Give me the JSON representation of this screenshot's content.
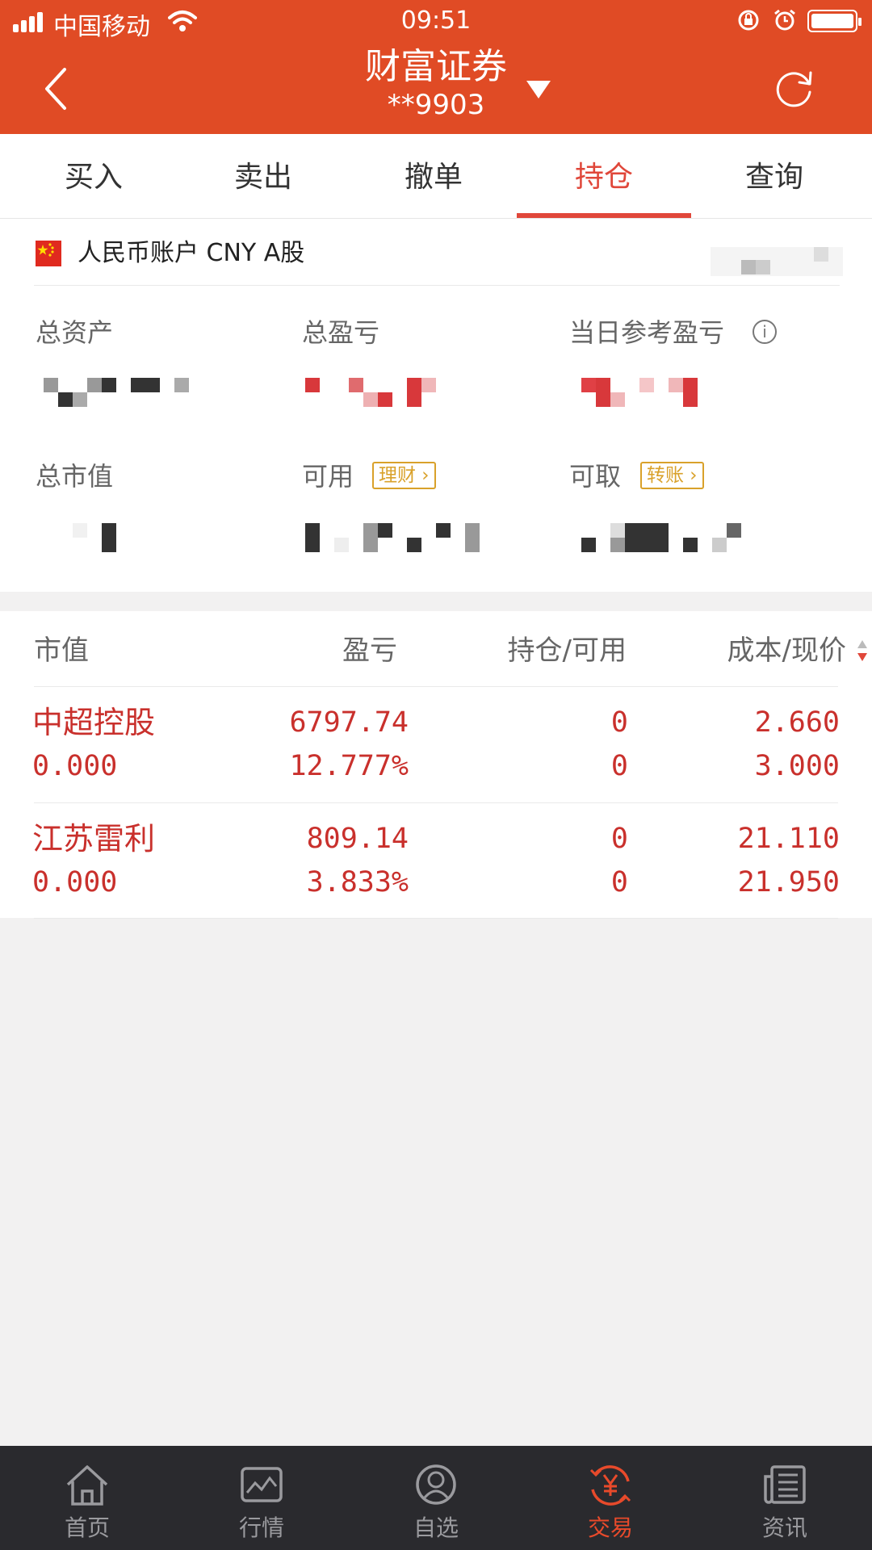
{
  "status_bar": {
    "carrier": "中国移动",
    "time": "09:51"
  },
  "header": {
    "title": "财富证券",
    "account": "**9903"
  },
  "tabs": [
    {
      "label": "买入",
      "active": false
    },
    {
      "label": "卖出",
      "active": false
    },
    {
      "label": "撤单",
      "active": false
    },
    {
      "label": "持仓",
      "active": true
    },
    {
      "label": "查询",
      "active": false
    }
  ],
  "account": {
    "name": "人民币账户 CNY A股",
    "labels": {
      "total_assets": "总资产",
      "total_pnl": "总盈亏",
      "daily_pnl": "当日参考盈亏",
      "market_value": "总市值",
      "available": "可用",
      "withdrawable": "可取"
    },
    "buttons": {
      "wealth": "理财",
      "transfer": "转账"
    }
  },
  "table": {
    "headers": {
      "market_value": "市值",
      "pnl": "盈亏",
      "position": "持仓/可用",
      "cost_price": "成本/现价"
    },
    "rows": [
      {
        "name": "中超控股",
        "market_value": "0.000",
        "pnl": "6797.74",
        "pnl_pct": "12.777%",
        "position": "0",
        "available": "0",
        "cost": "2.660",
        "price": "3.000"
      },
      {
        "name": "江苏雷利",
        "market_value": "0.000",
        "pnl": "809.14",
        "pnl_pct": "3.833%",
        "position": "0",
        "available": "0",
        "cost": "21.110",
        "price": "21.950"
      }
    ]
  },
  "nav": [
    {
      "label": "首页",
      "icon": "home-icon",
      "active": false
    },
    {
      "label": "行情",
      "icon": "market-chart-icon",
      "active": false
    },
    {
      "label": "自选",
      "icon": "watchlist-person-icon",
      "active": false
    },
    {
      "label": "交易",
      "icon": "trade-yuan-icon",
      "active": true
    },
    {
      "label": "资讯",
      "icon": "news-icon",
      "active": false
    }
  ],
  "colors": {
    "header": "#e04b25",
    "accent": "#e0473a",
    "gain": "#c9302c",
    "tag": "#d9a12a",
    "nav_bg": "#2a2a2e"
  }
}
